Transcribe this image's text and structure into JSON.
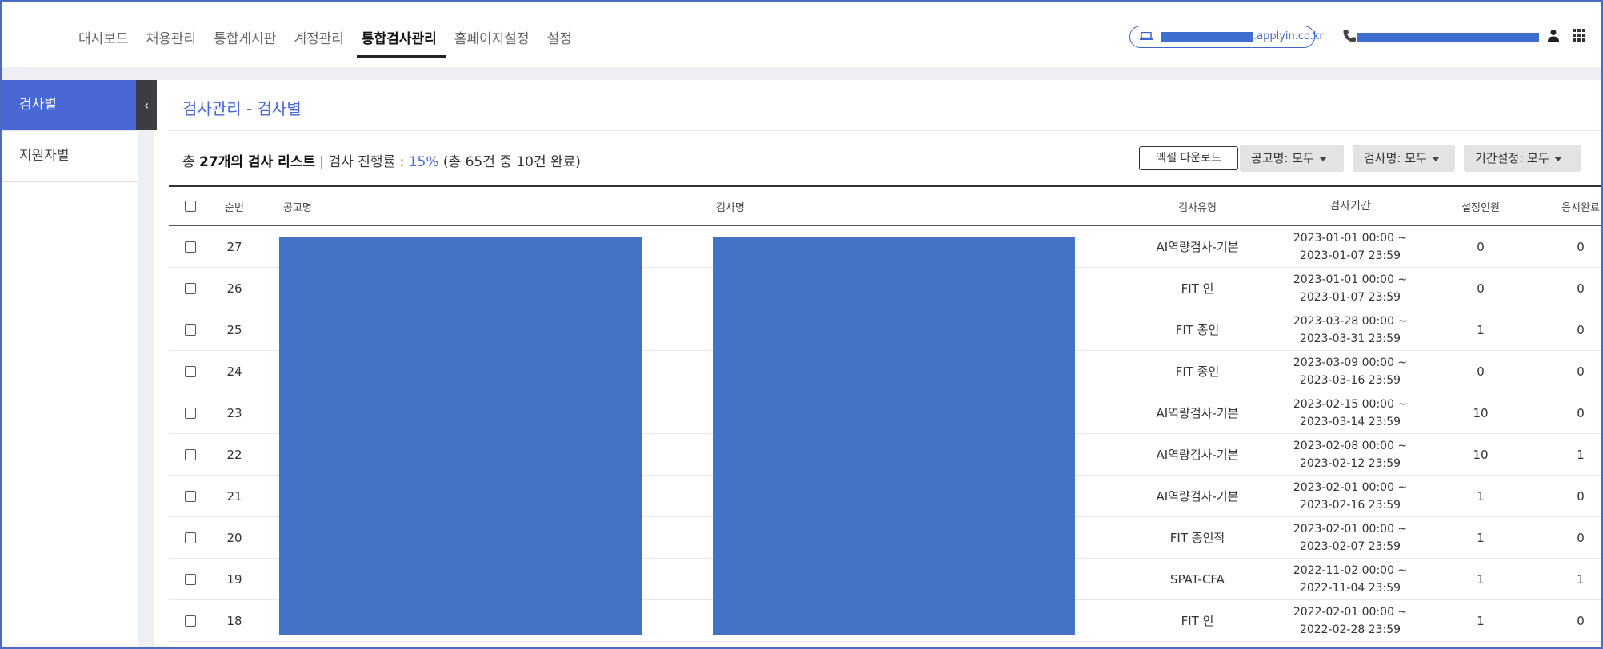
{
  "nav": {
    "items": [
      "대시보드",
      "채용관리",
      "통합게시판",
      "계정관리",
      "통합검사관리",
      "홈페이지설정",
      "설정"
    ],
    "active_index": 4
  },
  "header": {
    "domain_suffix": ".applyin.co.kr",
    "icons": [
      "laptop-icon",
      "phone-icon",
      "user-icon",
      "grid-icon"
    ]
  },
  "sidebar": {
    "items": [
      "검사별",
      "지원자별"
    ],
    "active_index": 0,
    "collapse_glyph": "‹"
  },
  "page": {
    "title": "검사관리 - 검사별"
  },
  "summary": {
    "prefix": "총 ",
    "count": "27개의 검사 리스트",
    "sep": " | 검사 진행률 : ",
    "percent": "15%",
    "detail": " (총 65건 중 10건 완료)"
  },
  "toolbar": {
    "excel_label": "엑셀 다운로드",
    "filter_job": "공고명: 모두",
    "filter_test": "검사명: 모두",
    "filter_period": "기간설정: 모두"
  },
  "table": {
    "headers": {
      "no": "순번",
      "job": "공고명",
      "test": "검사명",
      "type": "검사유형",
      "period": "검사기간",
      "set": "설정인원",
      "done": "응시완료"
    },
    "rows": [
      {
        "no": "27",
        "type": "AI역량검사-기본",
        "start": "2023-01-01 00:00 ~",
        "end": "2023-01-07 23:59",
        "set": "0",
        "done": "0"
      },
      {
        "no": "26",
        "type": "FIT 인",
        "start": "2023-01-01 00:00 ~",
        "end": "2023-01-07 23:59",
        "set": "0",
        "done": "0"
      },
      {
        "no": "25",
        "type": "FIT 종인",
        "start": "2023-03-28 00:00 ~",
        "end": "2023-03-31 23:59",
        "set": "1",
        "done": "0"
      },
      {
        "no": "24",
        "type": "FIT 종인",
        "start": "2023-03-09 00:00 ~",
        "end": "2023-03-16 23:59",
        "set": "0",
        "done": "0"
      },
      {
        "no": "23",
        "type": "AI역량검사-기본",
        "start": "2023-02-15 00:00 ~",
        "end": "2023-03-14 23:59",
        "set": "10",
        "done": "0"
      },
      {
        "no": "22",
        "type": "AI역량검사-기본",
        "start": "2023-02-08 00:00 ~",
        "end": "2023-02-12 23:59",
        "set": "10",
        "done": "1"
      },
      {
        "no": "21",
        "type": "AI역량검사-기본",
        "start": "2023-02-01 00:00 ~",
        "end": "2023-02-16 23:59",
        "set": "1",
        "done": "0"
      },
      {
        "no": "20",
        "type": "FIT 종인적",
        "start": "2023-02-01 00:00 ~",
        "end": "2023-02-07 23:59",
        "set": "1",
        "done": "0"
      },
      {
        "no": "19",
        "type": "SPAT-CFA",
        "start": "2022-11-02 00:00 ~",
        "end": "2022-11-04 23:59",
        "set": "1",
        "done": "1"
      },
      {
        "no": "18",
        "type": "FIT 인",
        "start": "2022-02-01 00:00 ~",
        "end": "2022-02-28 23:59",
        "set": "1",
        "done": "0"
      }
    ]
  },
  "colors": {
    "accent": "#4a67d6",
    "redaction": "#4472c4",
    "frame": "#4a6cc4"
  }
}
